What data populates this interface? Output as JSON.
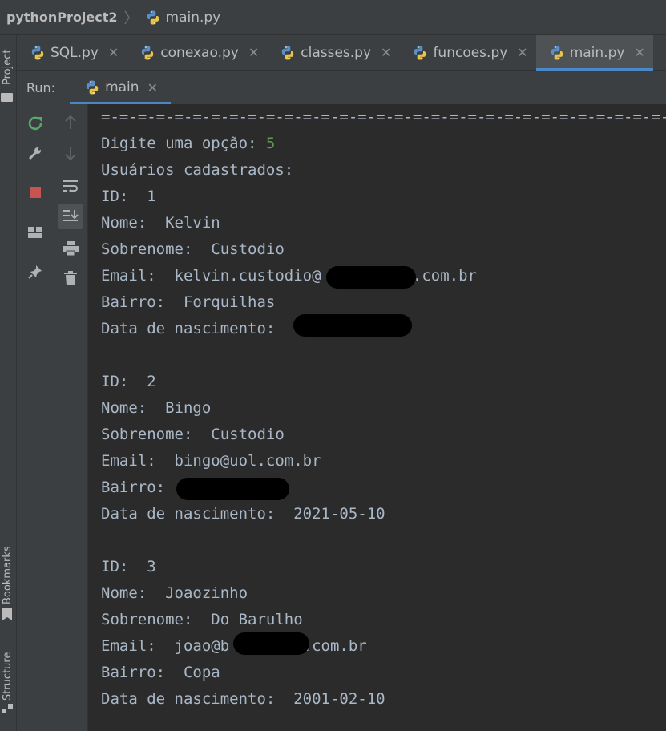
{
  "breadcrumb": {
    "project": "pythonProject2",
    "file": "main.py"
  },
  "side_strip": {
    "top_label": "Project",
    "bookmarks_label": "Bookmarks",
    "structure_label": "Structure"
  },
  "tabs": [
    {
      "label": "SQL.py",
      "active": false
    },
    {
      "label": "conexao.py",
      "active": false
    },
    {
      "label": "classes.py",
      "active": false
    },
    {
      "label": "funcoes.py",
      "active": false
    },
    {
      "label": "main.py",
      "active": true
    }
  ],
  "run": {
    "label": "Run:",
    "config": "main"
  },
  "toolbar_icons": [
    "rerun-icon",
    "wrench-icon",
    "stop-icon",
    "layout-icon",
    "pin-icon",
    "up-arrow-icon",
    "down-arrow-icon",
    "soft-wrap-icon",
    "scroll-to-end-icon",
    "print-icon",
    "trash-icon"
  ],
  "console": {
    "separator": "=-=-=-=-=-=-=-=-=-=-=-=-=-=-=-=-=-=-=-=-=-=-=-=-=-=-=-=-=-=-=-=-=-=-=-=",
    "prompt": "Digite uma opção: ",
    "input_value": "5",
    "header": "Usuários cadastrados:",
    "users": [
      {
        "id": "ID:  1",
        "nome": "Nome:  Kelvin",
        "sobrenome": "Sobrenome:  Custodio",
        "email": "Email:  kelvin.custodio@          .com.br",
        "bairro": "Bairro:  Forquilhas",
        "nascimento": "Data de nascimento:  "
      },
      {
        "id": "ID:  2",
        "nome": "Nome:  Bingo",
        "sobrenome": "Sobrenome:  Custodio",
        "email": "Email:  bingo@uol.com.br",
        "bairro": "Bairro:  ",
        "nascimento": "Data de nascimento:  2021-05-10"
      },
      {
        "id": "ID:  3",
        "nome": "Nome:  Joaozinho",
        "sobrenome": "Sobrenome:  Do Barulho",
        "email": "Email:  joao@b        .com.br",
        "bairro": "Bairro:  Copa",
        "nascimento": "Data de nascimento:  2001-02-10"
      }
    ]
  },
  "colors": {
    "background": "#2b2b2b",
    "panel": "#3c3f41",
    "text": "#a9b7c6",
    "input": "#629755",
    "accent": "#4a88c7",
    "redaction": "#000000"
  }
}
